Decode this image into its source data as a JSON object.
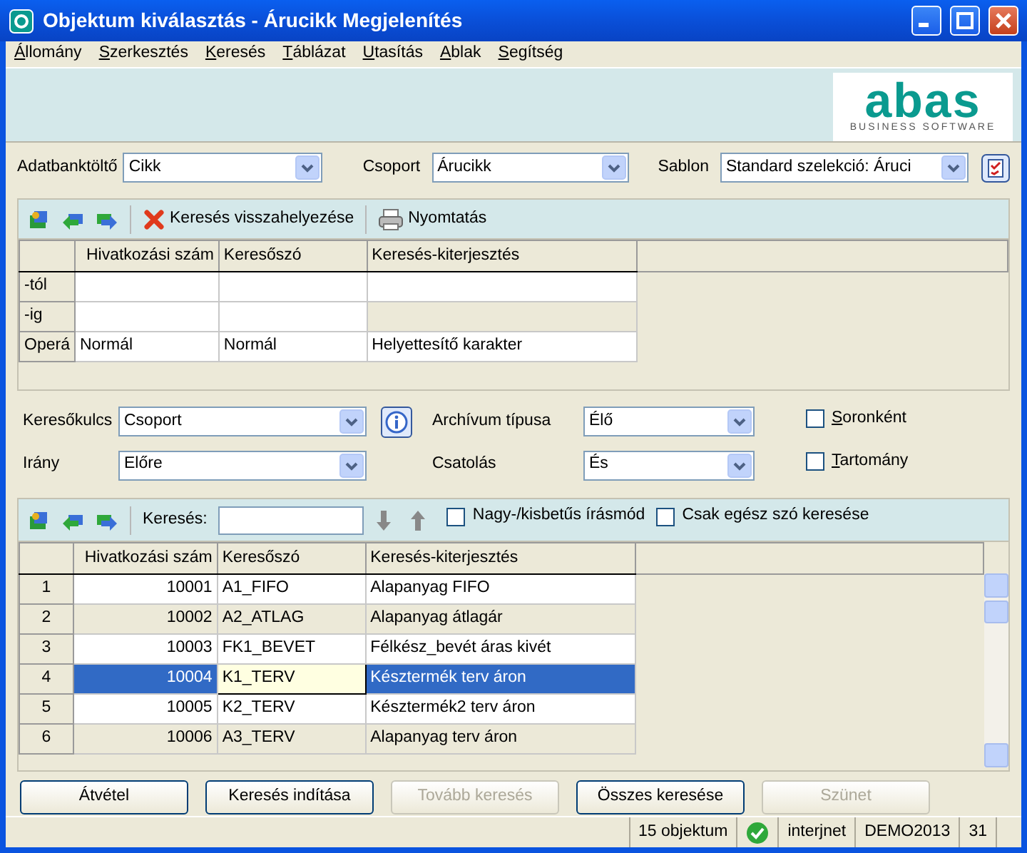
{
  "window": {
    "title": "Objektum kiválasztás - Árucikk Megjelenítés"
  },
  "menu": [
    "Állomány",
    "Szerkesztés",
    "Keresés",
    "Táblázat",
    "Utasítás",
    "Ablak",
    "Segítség"
  ],
  "logo": {
    "name": "abas",
    "tagline": "BUSINESS SOFTWARE"
  },
  "selectors": [
    {
      "label": "Adatbanktöltő",
      "value": "Cikk"
    },
    {
      "label": "Csoport",
      "value": "Árucikk"
    },
    {
      "label": "Sablon",
      "value": "Standard szelekció: Áruci"
    }
  ],
  "criteria_toolbar": {
    "reset_label": "Keresés visszahelyezése",
    "print_label": "Nyomtatás"
  },
  "criteria_grid": {
    "columns": [
      "Hivatkozási szám",
      "Keresőszó",
      "Keresés-kiterjesztés"
    ],
    "rows": [
      {
        "label": "-tól",
        "cells": [
          {
            "disabled": false
          },
          {
            "disabled": false
          },
          {
            "disabled": false
          }
        ]
      },
      {
        "label": "-ig",
        "cells": [
          {
            "disabled": false
          },
          {
            "disabled": false
          },
          {
            "disabled": true
          }
        ]
      },
      {
        "label": "Operá",
        "cells": [
          {
            "text": "Normál",
            "disabled": false
          },
          {
            "text": "Normál",
            "disabled": false
          },
          {
            "text": "Helyettesítő karakter",
            "disabled": false
          }
        ]
      }
    ]
  },
  "options": {
    "left": [
      {
        "label": "Keresőkulcs",
        "value": "Csoport"
      },
      {
        "label": "Irány",
        "value": "Előre"
      }
    ],
    "middle": [
      {
        "label": "Archívum típusa",
        "value": "Élő"
      },
      {
        "label": "Csatolás",
        "value": "És"
      }
    ],
    "checkboxes": [
      {
        "label": "Soronként",
        "checked": false
      },
      {
        "label": "Tartomány",
        "checked": false
      }
    ]
  },
  "search_toolbar": {
    "label": "Keresés:",
    "checkboxes": [
      {
        "label": "Nagy-/kisbetűs írásmód",
        "checked": false
      },
      {
        "label": "Csak egész szó keresése",
        "checked": false
      }
    ]
  },
  "results": {
    "columns": [
      "Hivatkozási szám",
      "Keresőszó",
      "Keresés-kiterjesztés"
    ],
    "rows": [
      {
        "number": "1",
        "reference": "10001",
        "keyword": "A1_FIFO",
        "extension": "Alapanyag FIFO",
        "selected": false
      },
      {
        "number": "2",
        "reference": "10002",
        "keyword": "A2_ATLAG",
        "extension": "Alapanyag átlagár",
        "selected": false
      },
      {
        "number": "3",
        "reference": "10003",
        "keyword": "FK1_BEVET",
        "extension": "Félkész_bevét áras kivét",
        "selected": false
      },
      {
        "number": "4",
        "reference": "10004",
        "keyword": "K1_TERV",
        "extension": "Késztermék terv áron",
        "selected": true
      },
      {
        "number": "5",
        "reference": "10005",
        "keyword": "K2_TERV",
        "extension": "Késztermék2 terv áron",
        "selected": false
      },
      {
        "number": "6",
        "reference": "10006",
        "keyword": "A3_TERV",
        "extension": "Alapanyag terv áron",
        "selected": false
      }
    ]
  },
  "buttons": [
    {
      "label": "Átvétel",
      "disabled": false
    },
    {
      "label": "Keresés indítása",
      "disabled": false
    },
    {
      "label": "Tovább keresés",
      "disabled": true
    },
    {
      "label": "Összes keresése",
      "disabled": false
    },
    {
      "label": "Szünet",
      "disabled": true
    }
  ],
  "status_bar": {
    "count": "15 objektum",
    "connection": "interjnet",
    "client": "DEMO2013",
    "number": "31"
  }
}
